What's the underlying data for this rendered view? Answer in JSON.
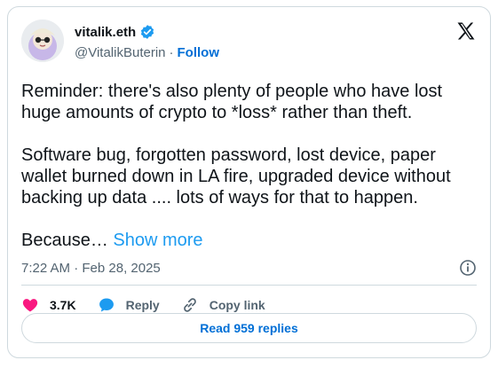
{
  "author": {
    "display_name": "vitalik.eth",
    "handle": "@VitalikButerin",
    "separator": "·",
    "follow_label": "Follow"
  },
  "tweet": {
    "text": "Reminder: there's also plenty of people who have lost huge amounts of crypto to *loss* rather than theft.\n\nSoftware bug, forgotten password, lost device, paper wallet burned down in LA fire, upgraded device without backing up data .... lots of ways for that to happen.\n\nBecause… ",
    "show_more": "Show more",
    "timestamp": "7:22 AM · Feb 28, 2025"
  },
  "actions": {
    "like_count": "3.7K",
    "reply_label": "Reply",
    "copy_link_label": "Copy link"
  },
  "footer": {
    "read_replies_label": "Read 959 replies"
  },
  "icons": {
    "verified": "verified-badge-icon",
    "x_logo": "x-logo-icon",
    "info": "info-icon",
    "heart": "heart-icon",
    "reply": "reply-bubble-icon",
    "link": "link-icon"
  },
  "colors": {
    "accent_link": "#1d9bf0",
    "follow": "#006fd6",
    "heart": "#f91880",
    "reply": "#1d9bf0",
    "text": "#0f1419",
    "muted": "#536471",
    "border": "#cfd9de"
  }
}
